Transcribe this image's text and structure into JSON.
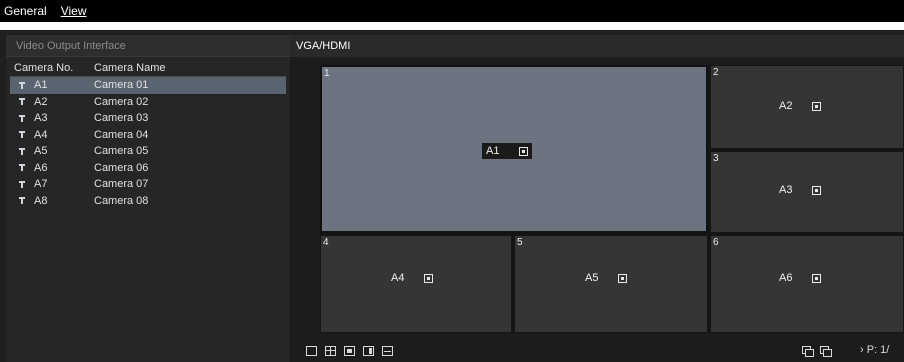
{
  "menu": {
    "tabs": [
      {
        "label": "General"
      },
      {
        "label": "View"
      }
    ]
  },
  "left_panel": {
    "header": "Video Output Interface",
    "columns": {
      "no": "Camera No.",
      "name": "Camera Name"
    },
    "cameras": [
      {
        "no": "A1",
        "name": "Camera 01"
      },
      {
        "no": "A2",
        "name": "Camera 02"
      },
      {
        "no": "A3",
        "name": "Camera 03"
      },
      {
        "no": "A4",
        "name": "Camera 04"
      },
      {
        "no": "A5",
        "name": "Camera 05"
      },
      {
        "no": "A6",
        "name": "Camera 06"
      },
      {
        "no": "A7",
        "name": "Camera 07"
      },
      {
        "no": "A8",
        "name": "Camera 08"
      }
    ]
  },
  "right_panel": {
    "header": "VGA/HDMI",
    "cells": [
      {
        "num": "1",
        "label": "A1"
      },
      {
        "num": "2",
        "label": "A2"
      },
      {
        "num": "3",
        "label": "A3"
      },
      {
        "num": "4",
        "label": "A4"
      },
      {
        "num": "5",
        "label": "A5"
      },
      {
        "num": "6",
        "label": "A6"
      }
    ],
    "page": "P: 1/"
  },
  "colors": {
    "selected_row": "#5a6470",
    "big_cell": "#6b7480",
    "cell": "#353535"
  },
  "icons": {
    "pin": "pin-icon",
    "delete": "delete-icon",
    "layout_1": "layout-single-icon",
    "layout_4": "layout-quad-icon",
    "layout_6": "layout-six-icon",
    "layout_8": "layout-eight-icon",
    "layout_9": "layout-nine-icon",
    "copy": "copy-icon"
  }
}
